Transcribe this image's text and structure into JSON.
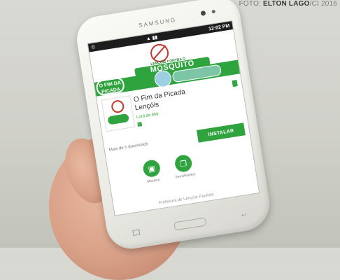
{
  "credit": {
    "prefix": "FOTO: ",
    "author": "ELTON LAGO",
    "suffix": "/CI 2016"
  },
  "phone": {
    "brand": "SAMSUNG"
  },
  "status": {
    "left": "©",
    "time": "12:02 PM",
    "icons": "▲ ▮▮"
  },
  "banner": {
    "line1": "LENÇÓIS CONTRA O",
    "line2": "MOSQUITO",
    "badge": "O FIM DA PICADA"
  },
  "app": {
    "name_line1": "O Fim da Picada",
    "name_line2": "Lençóis",
    "developer": "Lord de Mar",
    "rating": "L"
  },
  "actions": {
    "uninstall": "Mais de 5 downloads",
    "install": "INSTALAR"
  },
  "circles": [
    {
      "label": "Mosaico",
      "icon": "▣"
    },
    {
      "label": "Semelhantes",
      "icon": "❐"
    }
  ],
  "footer": "Prefeitura de Lençóis Paulista",
  "colors": {
    "green": "#2fa33d",
    "red": "#c0392b"
  }
}
